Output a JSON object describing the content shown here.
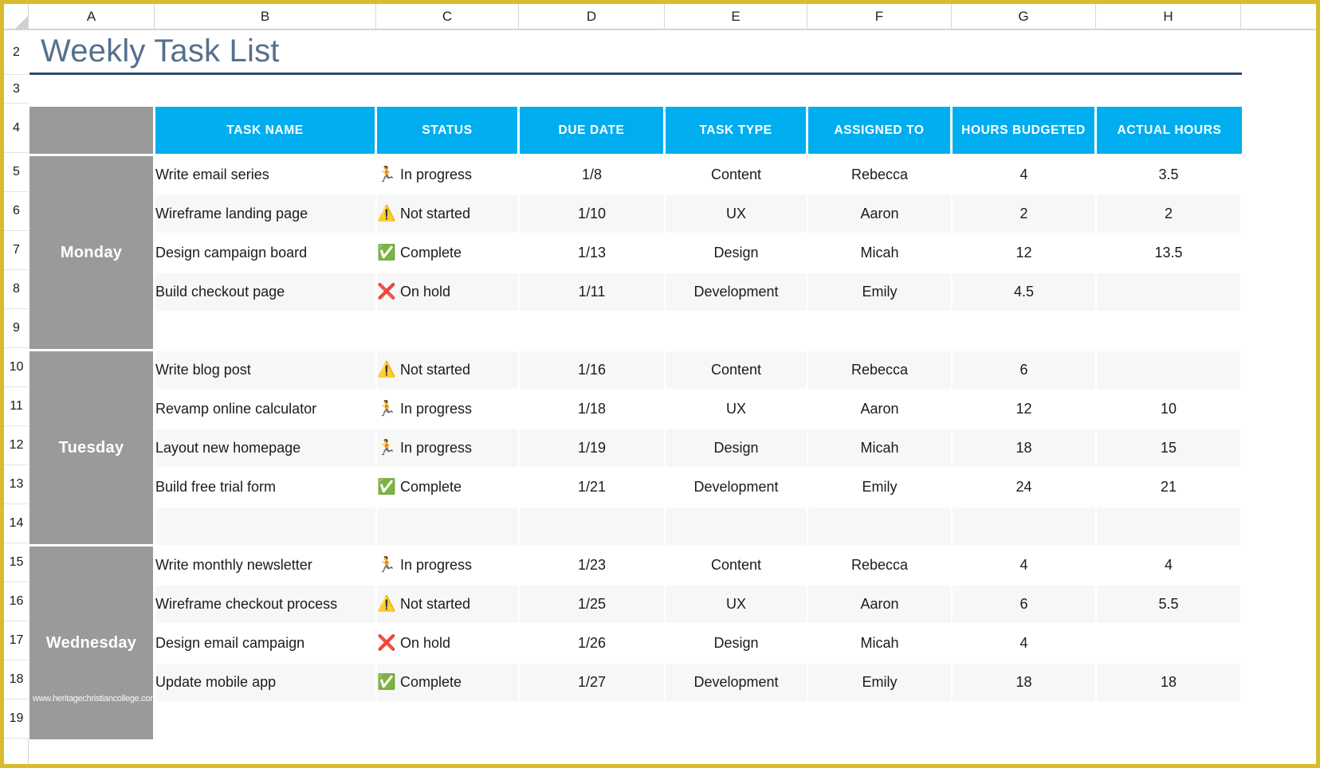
{
  "window": {
    "frame_color": "#d9bc2b",
    "accent_color": "#00AEEF",
    "day_band_color": "#9a9a9a",
    "title_color": "#56708c"
  },
  "grid": {
    "column_letters": [
      "A",
      "B",
      "C",
      "D",
      "E",
      "F",
      "G",
      "H"
    ],
    "row_numbers": [
      "2",
      "3",
      "4",
      "5",
      "6",
      "7",
      "8",
      "9",
      "10",
      "11",
      "12",
      "13",
      "14",
      "15",
      "16",
      "17",
      "18",
      "19"
    ]
  },
  "title": "Weekly Task List",
  "table": {
    "headers": [
      "",
      "TASK NAME",
      "STATUS",
      "DUE DATE",
      "TASK TYPE",
      "ASSIGNED TO",
      "HOURS BUDGETED",
      "ACTUAL HOURS"
    ],
    "status_icons": {
      "In progress": "🏃",
      "Not started": "⚠️",
      "Complete": "✅",
      "On hold": "❌"
    },
    "groups": [
      {
        "day": "Monday",
        "rows": [
          {
            "task": "Write email series",
            "status": "In progress",
            "icon": "🏃",
            "due": "1/8",
            "type": "Content",
            "assigned": "Rebecca",
            "budgeted": "4",
            "actual": "3.5"
          },
          {
            "task": "Wireframe landing page",
            "status": "Not started",
            "icon": "⚠️",
            "due": "1/10",
            "type": "UX",
            "assigned": "Aaron",
            "budgeted": "2",
            "actual": "2"
          },
          {
            "task": "Design campaign board",
            "status": "Complete",
            "icon": "✅",
            "due": "1/13",
            "type": "Design",
            "assigned": "Micah",
            "budgeted": "12",
            "actual": "13.5"
          },
          {
            "task": "Build checkout page",
            "status": "On hold",
            "icon": "❌",
            "due": "1/11",
            "type": "Development",
            "assigned": "Emily",
            "budgeted": "4.5",
            "actual": ""
          },
          {
            "task": "",
            "status": "",
            "icon": "",
            "due": "",
            "type": "",
            "assigned": "",
            "budgeted": "",
            "actual": ""
          }
        ]
      },
      {
        "day": "Tuesday",
        "rows": [
          {
            "task": "Write blog post",
            "status": "Not started",
            "icon": "⚠️",
            "due": "1/16",
            "type": "Content",
            "assigned": "Rebecca",
            "budgeted": "6",
            "actual": ""
          },
          {
            "task": "Revamp online calculator",
            "status": "In progress",
            "icon": "🏃",
            "due": "1/18",
            "type": "UX",
            "assigned": "Aaron",
            "budgeted": "12",
            "actual": "10"
          },
          {
            "task": "Layout new homepage",
            "status": "In progress",
            "icon": "🏃",
            "due": "1/19",
            "type": "Design",
            "assigned": "Micah",
            "budgeted": "18",
            "actual": "15"
          },
          {
            "task": "Build free trial form",
            "status": "Complete",
            "icon": "✅",
            "due": "1/21",
            "type": "Development",
            "assigned": "Emily",
            "budgeted": "24",
            "actual": "21"
          },
          {
            "task": "",
            "status": "",
            "icon": "",
            "due": "",
            "type": "",
            "assigned": "",
            "budgeted": "",
            "actual": ""
          }
        ]
      },
      {
        "day": "Wednesday",
        "rows": [
          {
            "task": "Write monthly newsletter",
            "status": "In progress",
            "icon": "🏃",
            "due": "1/23",
            "type": "Content",
            "assigned": "Rebecca",
            "budgeted": "4",
            "actual": "4"
          },
          {
            "task": "Wireframe checkout process",
            "status": "Not started",
            "icon": "⚠️",
            "due": "1/25",
            "type": "UX",
            "assigned": "Aaron",
            "budgeted": "6",
            "actual": "5.5"
          },
          {
            "task": "Design email campaign",
            "status": "On hold",
            "icon": "❌",
            "due": "1/26",
            "type": "Design",
            "assigned": "Micah",
            "budgeted": "4",
            "actual": ""
          },
          {
            "task": "Update mobile app",
            "status": "Complete",
            "icon": "✅",
            "due": "1/27",
            "type": "Development",
            "assigned": "Emily",
            "budgeted": "18",
            "actual": "18"
          },
          {
            "task": "",
            "status": "",
            "icon": "",
            "due": "",
            "type": "",
            "assigned": "",
            "budgeted": "",
            "actual": ""
          }
        ]
      }
    ]
  },
  "watermark": "www.heritagechristiancollege.com"
}
